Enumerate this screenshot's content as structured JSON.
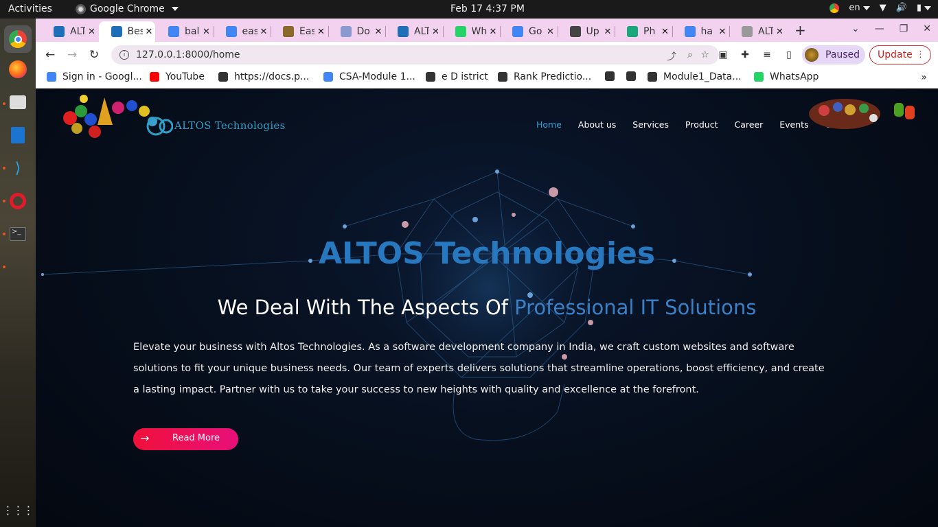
{
  "topbar": {
    "activities": "Activities",
    "app_name": "Google Chrome",
    "clock": "Feb 17  4:37 PM",
    "lang": "en"
  },
  "tabs": [
    {
      "label": "ALTOS",
      "icon": "altos-icon",
      "color": "#1f6fb8"
    },
    {
      "label": "Best",
      "icon": "altos-icon",
      "color": "#1f6fb8",
      "active": true
    },
    {
      "label": "bal",
      "icon": "google-icon",
      "color": "#4285f4"
    },
    {
      "label": "eas",
      "icon": "google-icon",
      "color": "#4285f4"
    },
    {
      "label": "Eas",
      "icon": "user-icon",
      "color": "#8a6a2a"
    },
    {
      "label": "Do",
      "icon": "w-icon",
      "color": "#8a9ad0"
    },
    {
      "label": "ALT",
      "icon": "altos-icon",
      "color": "#1f6fb8"
    },
    {
      "label": "Wh",
      "icon": "whatsapp-icon",
      "color": "#25d366"
    },
    {
      "label": "Go",
      "icon": "google-icon",
      "color": "#4285f4"
    },
    {
      "label": "Up",
      "icon": "cap-icon",
      "color": "#444"
    },
    {
      "label": "Ph",
      "icon": "ph-icon",
      "color": "#1aa87a"
    },
    {
      "label": "ha",
      "icon": "google-icon",
      "color": "#4285f4"
    },
    {
      "label": "ALT",
      "icon": "doc-icon",
      "color": "#999"
    }
  ],
  "toolbar": {
    "url": "127.0.0.1:8000/home",
    "profile_status": "Paused",
    "update_label": "Update"
  },
  "bookmarks": [
    {
      "label": "Sign in - Googl...",
      "icon": "google-icon",
      "color": "#4285f4"
    },
    {
      "label": "YouTube",
      "icon": "youtube-icon",
      "color": "#ff0000"
    },
    {
      "label": "https://docs.p...",
      "icon": "docs-icon",
      "color": "#333"
    },
    {
      "label": "CSA-Module 1...",
      "icon": "google-icon",
      "color": "#4285f4"
    },
    {
      "label": "e D istrict",
      "icon": "globe-icon",
      "color": "#333"
    },
    {
      "label": "Rank Predictio...",
      "icon": "globe-icon",
      "color": "#333"
    },
    {
      "label": "",
      "icon": "globe-icon",
      "color": "#333"
    },
    {
      "label": "",
      "icon": "globe-icon",
      "color": "#333"
    },
    {
      "label": "Module1_Data...",
      "icon": "globe-icon",
      "color": "#333"
    },
    {
      "label": "WhatsApp",
      "icon": "whatsapp-icon",
      "color": "#25d366"
    }
  ],
  "site": {
    "brand": "ALTOS Technologies",
    "nav": [
      "Home",
      "About us",
      "Services",
      "Product",
      "Career",
      "Events",
      "Contact"
    ],
    "hero_title": "ALTOS Technologies",
    "hero_sub_plain": "We Deal With The Aspects Of ",
    "hero_sub_highlight": "Professional IT Solutions",
    "hero_desc": "Elevate your business with Altos Technologies. As a software development company in India, we craft custom websites and software solutions to fit your unique business needs. Our team of experts delivers solutions that streamline operations, boost efficiency, and create a lasting impact. Partner with us to take your success to new heights with quality and excellence at the forefront.",
    "read_more": "Read More"
  },
  "colors": {
    "tabstrip": "#f3d2f0",
    "brand": "#2ea0c8",
    "hero_title": "#2878c0",
    "highlight": "#3a80c6",
    "button_start": "#f0103a",
    "button_end": "#e8107a"
  }
}
